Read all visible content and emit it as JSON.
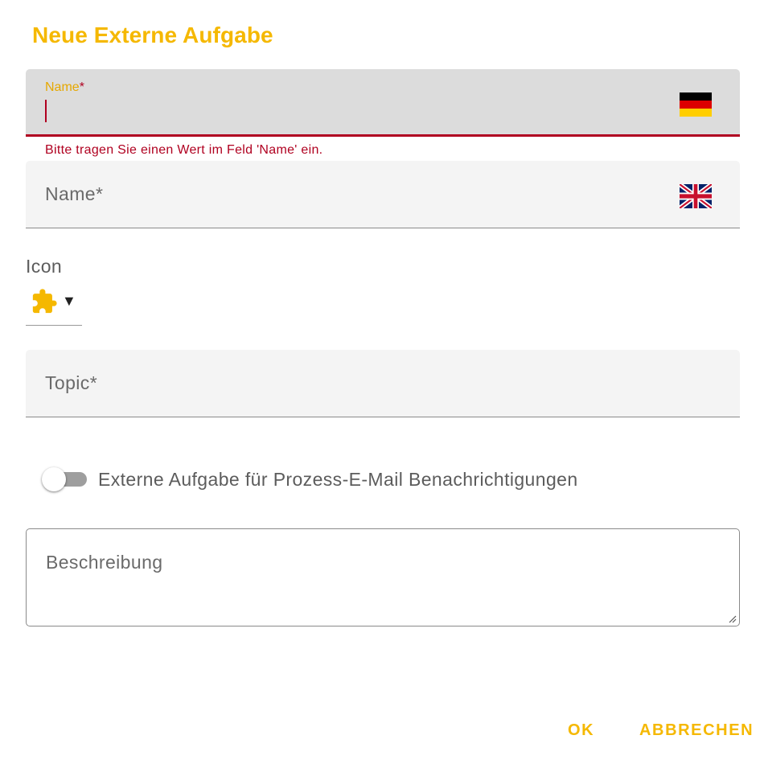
{
  "dialog": {
    "title": "Neue Externe Aufgabe"
  },
  "name_de": {
    "label": "Name",
    "required_marker": "*",
    "value": "",
    "flag_icon": "german-flag-icon",
    "error": "Bitte tragen Sie einen Wert im Feld 'Name' ein."
  },
  "name_en": {
    "label": "Name*",
    "value": "",
    "flag_icon": "uk-flag-icon"
  },
  "icon": {
    "label": "Icon",
    "selected_icon": "puzzle-piece-icon",
    "dropdown_glyph": "▼"
  },
  "topic": {
    "label": "Topic*",
    "value": ""
  },
  "notification_toggle": {
    "label": "Externe Aufgabe für Prozess-E-Mail Benachrichtigungen",
    "checked": false
  },
  "description": {
    "label": "Beschreibung",
    "value": ""
  },
  "actions": {
    "ok_label": "OK",
    "cancel_label": "ABBRECHEN"
  },
  "colors": {
    "accent": "#f5b800",
    "error": "#b00020",
    "field_bg": "#f4f4f4",
    "active_field_bg": "#dcdcdc"
  }
}
